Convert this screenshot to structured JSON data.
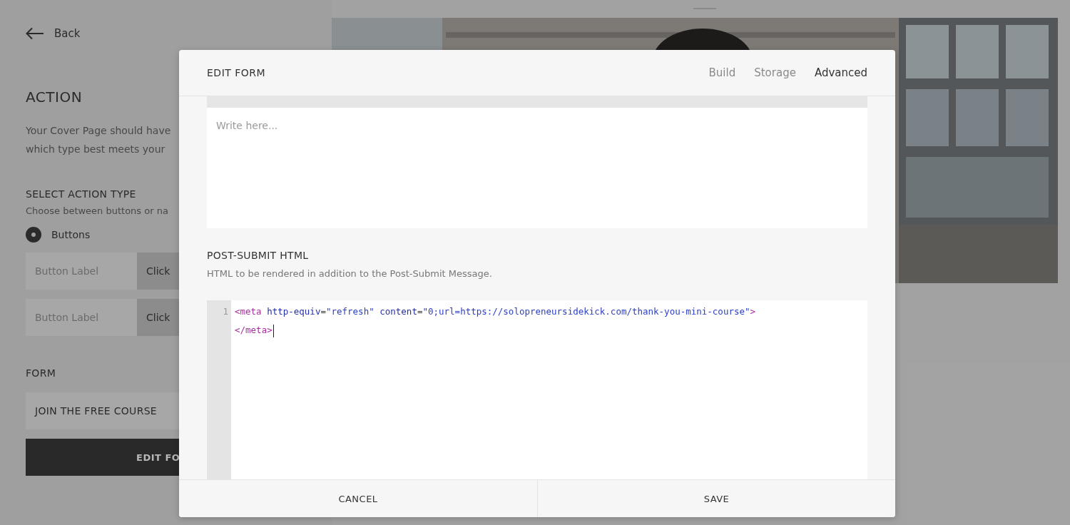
{
  "sidebar": {
    "back": "Back",
    "title": "ACTION",
    "description_lines": [
      "Your Cover Page should have",
      "which type best meets your"
    ],
    "action_type": {
      "heading": "SELECT ACTION TYPE",
      "hint": "Choose between buttons or na",
      "options": [
        {
          "label": "Buttons",
          "selected": true
        }
      ]
    },
    "button_rows": [
      {
        "placeholder": "Button Label",
        "link": "Click"
      },
      {
        "placeholder": "Button Label",
        "link": "Click"
      }
    ],
    "form": {
      "heading": "FORM",
      "value": "JOIN THE FREE COURSE",
      "button": "EDIT FO"
    }
  },
  "modal": {
    "title": "EDIT FORM",
    "tabs": [
      {
        "label": "Build",
        "selected": false
      },
      {
        "label": "Storage",
        "selected": false
      },
      {
        "label": "Advanced",
        "selected": true
      }
    ],
    "message_editor": {
      "placeholder": "Write here..."
    },
    "post_submit": {
      "heading": "POST-SUBMIT HTML",
      "description": "HTML to be rendered in addition to the Post-Submit Message.",
      "code_lines": [
        {
          "number": "1",
          "tokens": [
            {
              "kind": "tag",
              "text": "<meta"
            },
            {
              "kind": "attr",
              "text": " http-equiv"
            },
            {
              "kind": "text",
              "text": "="
            },
            {
              "kind": "string",
              "text": "\"refresh\""
            },
            {
              "kind": "attr",
              "text": " content"
            },
            {
              "kind": "text",
              "text": "="
            },
            {
              "kind": "string",
              "text": "\"0;url=https://solopreneursidekick.com/thank-you-mini-course\""
            },
            {
              "kind": "tag",
              "text": ">"
            }
          ]
        },
        {
          "tokens": [
            {
              "kind": "tag",
              "text": "</meta>"
            }
          ]
        }
      ]
    },
    "buttons": [
      "CANCEL",
      "SAVE"
    ]
  }
}
